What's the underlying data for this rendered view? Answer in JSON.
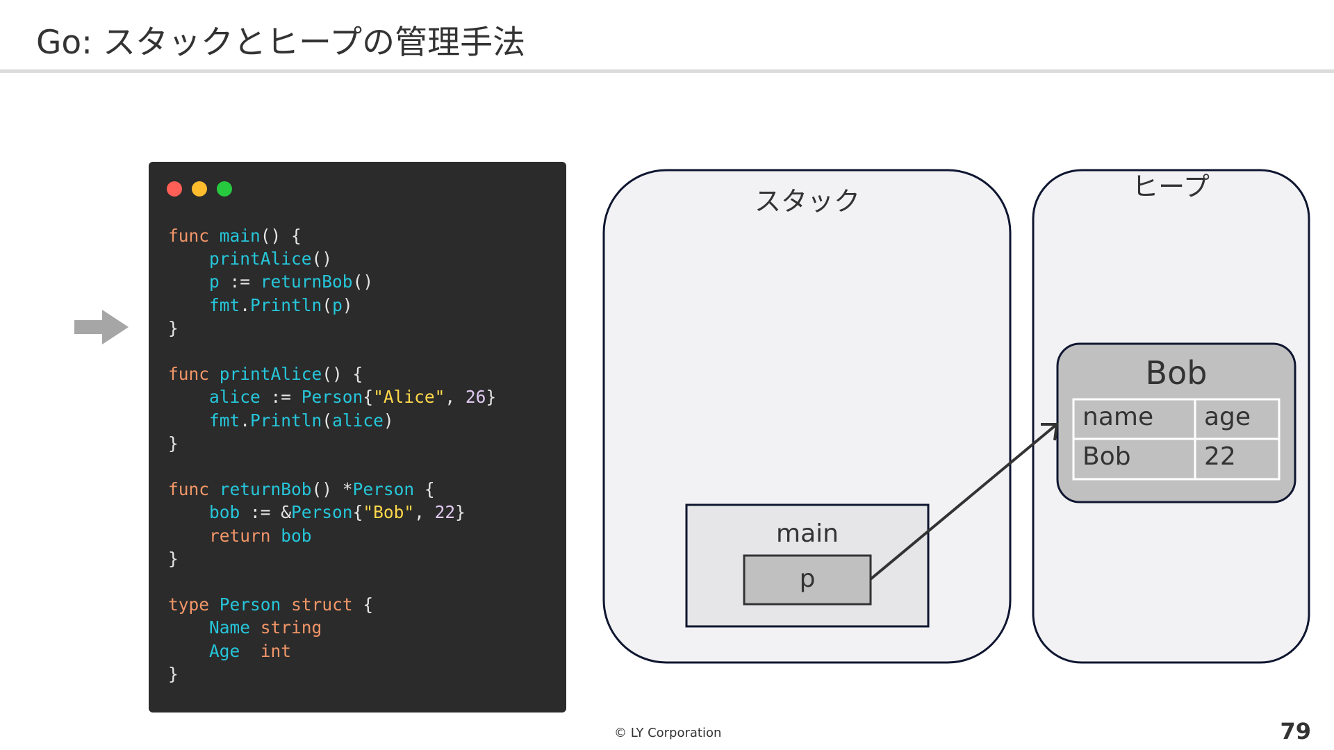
{
  "slide": {
    "title": "Go: スタックとヒープの管理手法",
    "footer": "© LY Corporation",
    "page_number": "79"
  },
  "code_window": {
    "lines": [
      [
        [
          "kw",
          "func"
        ],
        [
          "op",
          " "
        ],
        [
          "fn",
          "main"
        ],
        [
          "op",
          "() {"
        ]
      ],
      [
        [
          "op",
          "    "
        ],
        [
          "fn",
          "printAlice"
        ],
        [
          "op",
          "()"
        ]
      ],
      [
        [
          "op",
          "    "
        ],
        [
          "fn",
          "p"
        ],
        [
          "op",
          " := "
        ],
        [
          "fn",
          "returnBob"
        ],
        [
          "op",
          "()"
        ]
      ],
      [
        [
          "op",
          "    "
        ],
        [
          "fn",
          "fmt"
        ],
        [
          "op",
          "."
        ],
        [
          "fn",
          "Println"
        ],
        [
          "op",
          "("
        ],
        [
          "fn",
          "p"
        ],
        [
          "op",
          ")"
        ]
      ],
      [
        [
          "op",
          "}"
        ]
      ],
      [
        [
          "op",
          ""
        ]
      ],
      [
        [
          "kw",
          "func"
        ],
        [
          "op",
          " "
        ],
        [
          "fn",
          "printAlice"
        ],
        [
          "op",
          "() {"
        ]
      ],
      [
        [
          "op",
          "    "
        ],
        [
          "fn",
          "alice"
        ],
        [
          "op",
          " := "
        ],
        [
          "fn",
          "Person"
        ],
        [
          "op",
          "{"
        ],
        [
          "str",
          "\"Alice\""
        ],
        [
          "op",
          ", "
        ],
        [
          "num",
          "26"
        ],
        [
          "op",
          "}"
        ]
      ],
      [
        [
          "op",
          "    "
        ],
        [
          "fn",
          "fmt"
        ],
        [
          "op",
          "."
        ],
        [
          "fn",
          "Println"
        ],
        [
          "op",
          "("
        ],
        [
          "fn",
          "alice"
        ],
        [
          "op",
          ")"
        ]
      ],
      [
        [
          "op",
          "}"
        ]
      ],
      [
        [
          "op",
          ""
        ]
      ],
      [
        [
          "kw",
          "func"
        ],
        [
          "op",
          " "
        ],
        [
          "fn",
          "returnBob"
        ],
        [
          "op",
          "() *"
        ],
        [
          "fn",
          "Person"
        ],
        [
          "op",
          " {"
        ]
      ],
      [
        [
          "op",
          "    "
        ],
        [
          "fn",
          "bob"
        ],
        [
          "op",
          " := &"
        ],
        [
          "fn",
          "Person"
        ],
        [
          "op",
          "{"
        ],
        [
          "str",
          "\"Bob\""
        ],
        [
          "op",
          ", "
        ],
        [
          "num",
          "22"
        ],
        [
          "op",
          "}"
        ]
      ],
      [
        [
          "op",
          "    "
        ],
        [
          "kw",
          "return"
        ],
        [
          "op",
          " "
        ],
        [
          "fn",
          "bob"
        ]
      ],
      [
        [
          "op",
          "}"
        ]
      ],
      [
        [
          "op",
          ""
        ]
      ],
      [
        [
          "kw",
          "type"
        ],
        [
          "op",
          " "
        ],
        [
          "fn",
          "Person"
        ],
        [
          "op",
          " "
        ],
        [
          "kw",
          "struct"
        ],
        [
          "op",
          " {"
        ]
      ],
      [
        [
          "op",
          "    "
        ],
        [
          "fn",
          "Name"
        ],
        [
          "op",
          " "
        ],
        [
          "kw",
          "string"
        ]
      ],
      [
        [
          "op",
          "    "
        ],
        [
          "fn",
          "Age"
        ],
        [
          "op",
          "  "
        ],
        [
          "kw",
          "int"
        ]
      ],
      [
        [
          "op",
          "}"
        ]
      ]
    ]
  },
  "diagram": {
    "stack_label": "スタック",
    "heap_label": "ヒープ",
    "frame_label": "main",
    "variable_label": "p",
    "object": {
      "name": "Bob",
      "columns": [
        "name",
        "age"
      ],
      "values": [
        "Bob",
        "22"
      ]
    }
  },
  "colors": {
    "code_background": "#2b2b2b",
    "keyword": "#f29668",
    "identifier": "#26c6da",
    "string": "#ffd84a",
    "number": "#e0c9f0",
    "region_fill": "#f2f2f4",
    "object_fill": "#c0c0c0",
    "pointer_arrow": "#a6a6a6"
  }
}
